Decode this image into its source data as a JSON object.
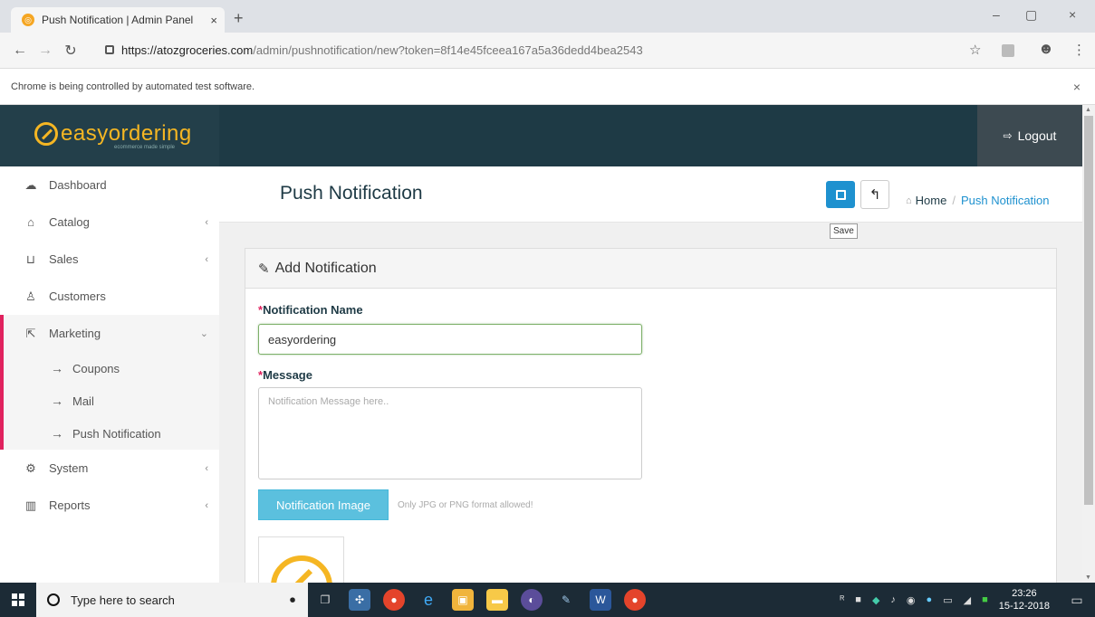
{
  "browser": {
    "tab_title": "Push Notification | Admin Panel",
    "tab_close": "×",
    "new_tab": "+",
    "url_host": "https://atozgroceries.com",
    "url_path": "/admin/pushnotification/new?token=8f14e45fceea167a5a36dedd4bea2543",
    "infobar_text": "Chrome is being controlled by automated test software.",
    "infobar_close": "×",
    "minimize": "–",
    "restore": "▢",
    "close": "×"
  },
  "header": {
    "logo_text": "easyordering",
    "logo_tagline": "ecommerce made simple",
    "logout_label": "Logout",
    "logout_icon": "⇨"
  },
  "sidebar": {
    "items": [
      {
        "label": "Dashboard",
        "icon": "dashboard-icon",
        "glyph": "☁"
      },
      {
        "label": "Catalog",
        "icon": "tag-icon",
        "glyph": "⌂"
      },
      {
        "label": "Sales",
        "icon": "cart-icon",
        "glyph": "⊔"
      },
      {
        "label": "Customers",
        "icon": "user-icon",
        "glyph": "♙"
      },
      {
        "label": "Marketing",
        "icon": "share-icon",
        "glyph": "⇱"
      },
      {
        "label": "System",
        "icon": "cog-icon",
        "glyph": "⚙"
      },
      {
        "label": "Reports",
        "icon": "bar-chart-icon",
        "glyph": "▥"
      }
    ],
    "sub_items": [
      {
        "label": "Coupons"
      },
      {
        "label": "Mail"
      },
      {
        "label": "Push Notification"
      }
    ],
    "arrow": "→",
    "chevron_left": "‹",
    "chevron_down": "⌄"
  },
  "page": {
    "title": "Push Notification",
    "save_tooltip": "Save",
    "back_glyph": "↰",
    "breadcrumb": {
      "home": "Home",
      "separator": "/",
      "current": "Push Notification"
    }
  },
  "form": {
    "panel_title": "Add Notification",
    "required_mark": "*",
    "name_label": "Notification Name",
    "name_value": "easyordering",
    "message_label": "Message",
    "message_placeholder": "Notification Message here..",
    "image_button": "Notification Image",
    "image_hint": "Only JPG or PNG format allowed!"
  },
  "taskbar": {
    "search_placeholder": "Type here to search",
    "time": "23:26",
    "date": "15-12-2018"
  },
  "colors": {
    "header_bg": "#1e3a45",
    "accent_blue": "#1e91cf",
    "logo_yellow": "#f5b623",
    "active_border": "#e0225e",
    "info_button": "#5bc0de"
  }
}
